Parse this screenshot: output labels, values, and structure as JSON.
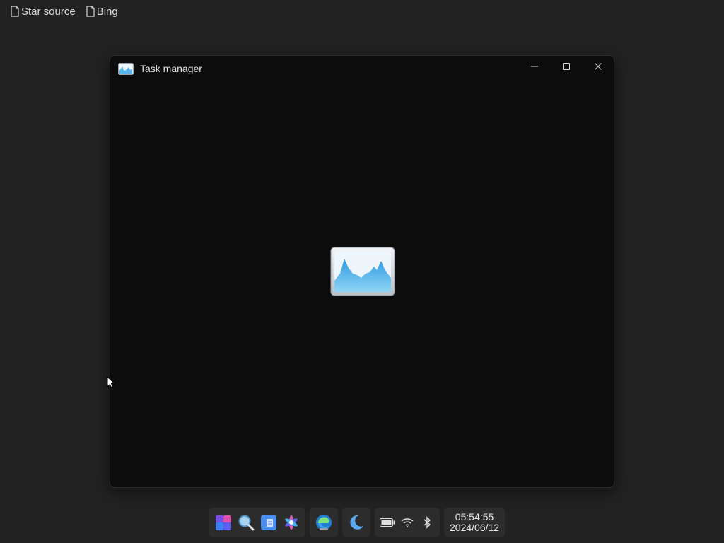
{
  "desktop": {
    "shortcuts": [
      {
        "label": "Star source",
        "icon": "document-icon"
      },
      {
        "label": "Bing",
        "icon": "document-icon"
      }
    ]
  },
  "window": {
    "title": "Task manager",
    "icon": "task-manager-icon",
    "controls": [
      "minimize-icon",
      "maximize-icon",
      "close-icon"
    ]
  },
  "taskbar": {
    "pinned": [
      "widgets-icon",
      "search-icon",
      "notepad-icon",
      "settings-icon"
    ],
    "running": [
      {
        "icon": "edge-icon",
        "active": true
      }
    ],
    "other": [
      {
        "icon": "moon-icon"
      }
    ],
    "tray": [
      "battery-icon",
      "wifi-icon",
      "bluetooth-icon"
    ],
    "clock": {
      "time": "05:54:55",
      "date": "2024/06/12"
    }
  },
  "colors": {
    "desktop_bg": "#222222",
    "window_bg": "#0c0c0c",
    "taskbar_bg": "#2c2c2c",
    "accent": "#4fa8e8"
  }
}
